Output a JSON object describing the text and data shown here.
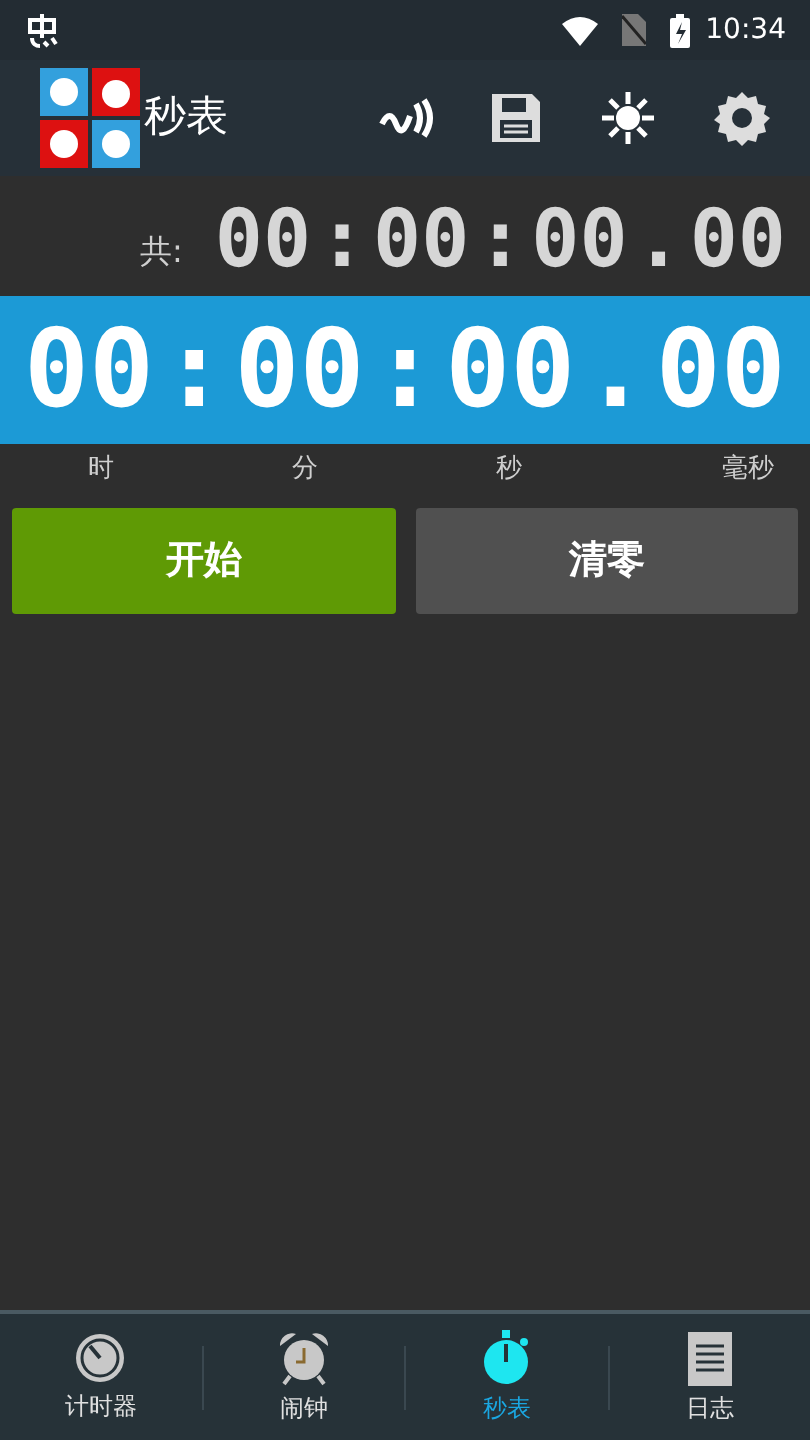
{
  "status_bar": {
    "time": "10:34"
  },
  "app_bar": {
    "title": "秒表"
  },
  "total": {
    "label": "共:",
    "parts": [
      "00",
      ":",
      "00",
      ":",
      "00",
      ".",
      "00"
    ]
  },
  "display": {
    "parts": [
      "00",
      ":",
      "00",
      ":",
      "00",
      ".",
      "00"
    ],
    "units": [
      "时",
      "分",
      "秒",
      "毫秒"
    ]
  },
  "buttons": [
    {
      "label": "开始",
      "kind": "start"
    },
    {
      "label": "清零",
      "kind": "reset"
    }
  ],
  "nav": [
    {
      "label": "计时器",
      "kind": "timer",
      "selected": false
    },
    {
      "label": "闹钟",
      "kind": "alarm",
      "selected": false
    },
    {
      "label": "秒表",
      "kind": "stopwatch",
      "selected": true
    },
    {
      "label": "日志",
      "kind": "log",
      "selected": false
    }
  ]
}
